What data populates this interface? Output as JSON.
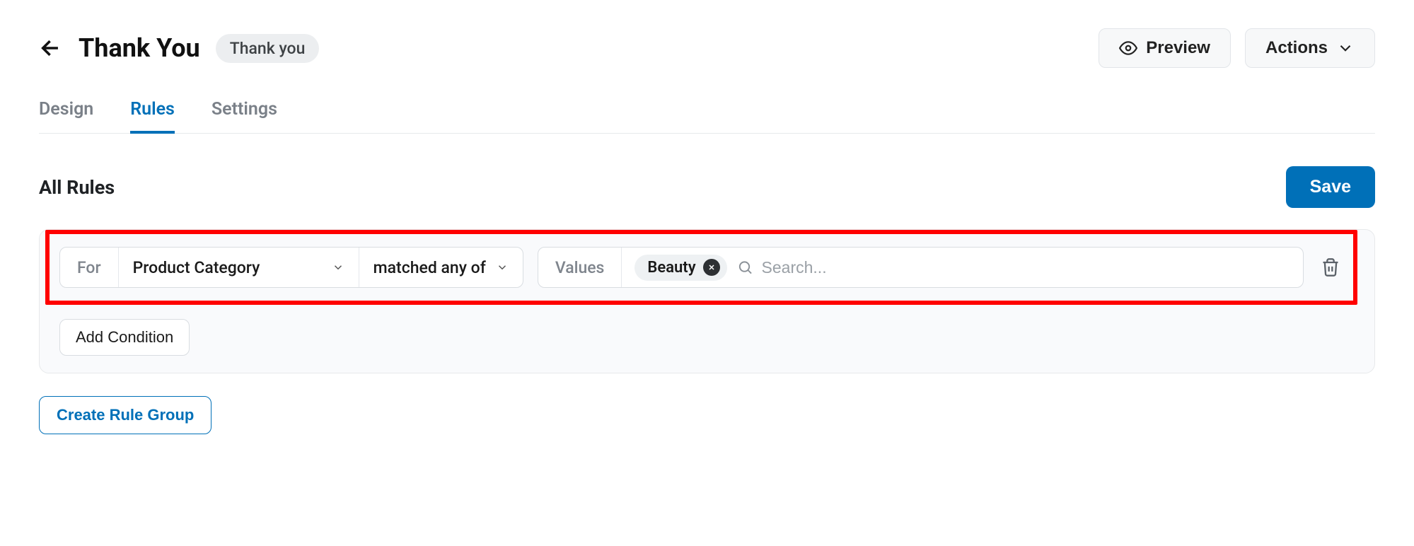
{
  "header": {
    "title": "Thank You",
    "badge": "Thank you",
    "preview_label": "Preview",
    "actions_label": "Actions"
  },
  "tabs": {
    "design": "Design",
    "rules": "Rules",
    "settings": "Settings",
    "active": "rules"
  },
  "section": {
    "title": "All Rules",
    "save_label": "Save"
  },
  "rule": {
    "for_label": "For",
    "field": "Product Category",
    "operator": "matched any of",
    "values_label": "Values",
    "chips": [
      "Beauty"
    ],
    "search_placeholder": "Search..."
  },
  "buttons": {
    "add_condition": "Add Condition",
    "create_group": "Create Rule Group"
  }
}
